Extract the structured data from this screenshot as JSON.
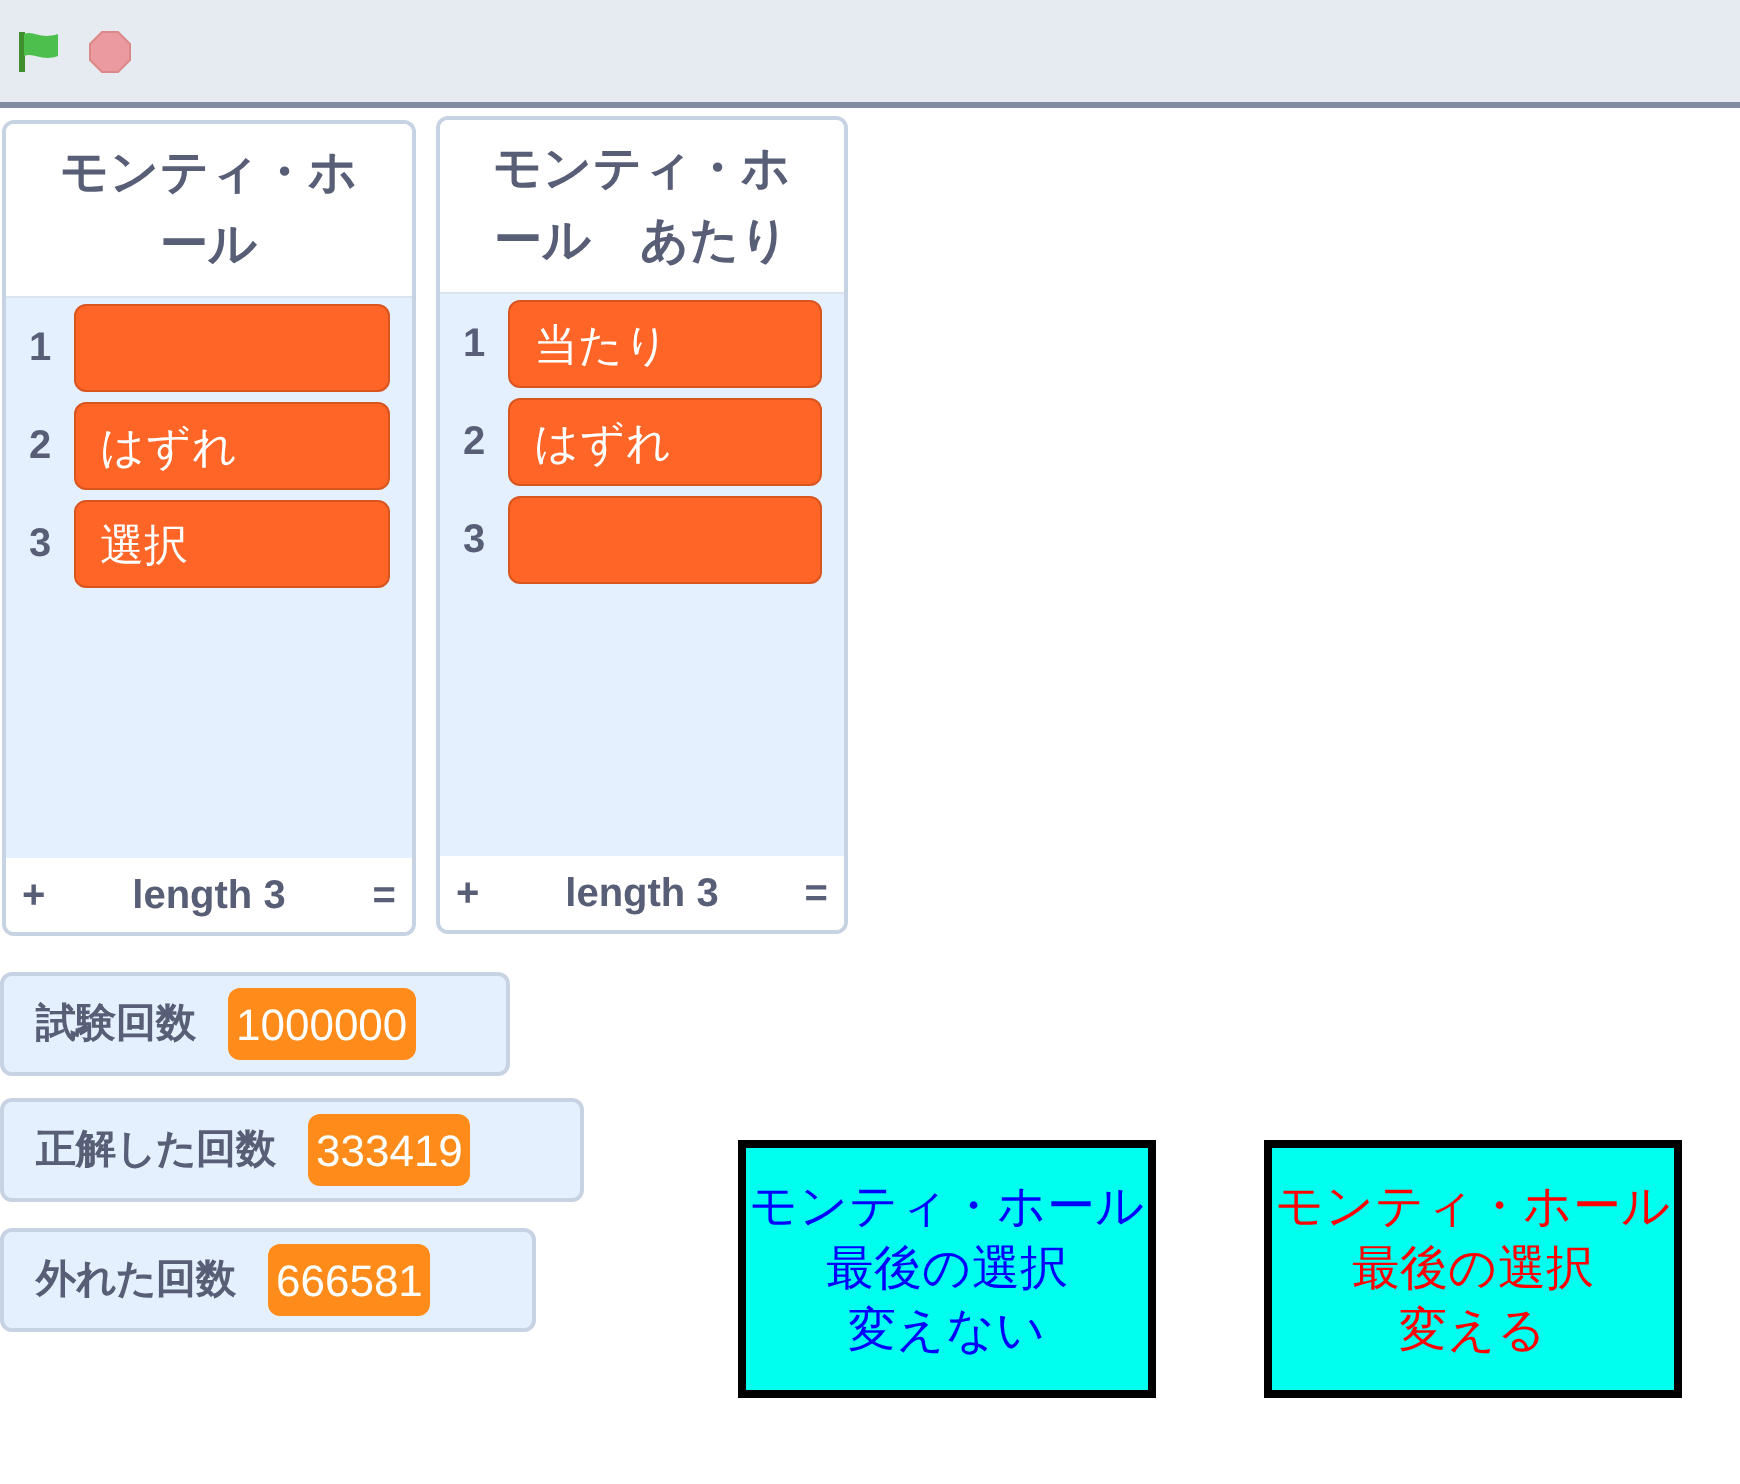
{
  "lists": [
    {
      "title": "モンティ・ホール",
      "items": [
        {
          "index": "1",
          "value": ""
        },
        {
          "index": "2",
          "value": "はずれ"
        },
        {
          "index": "3",
          "value": "選択"
        }
      ],
      "add": "+",
      "length": "length 3",
      "resize": "="
    },
    {
      "title": "モンティ・ホール　あたり",
      "items": [
        {
          "index": "1",
          "value": "当たり"
        },
        {
          "index": "2",
          "value": "はずれ"
        },
        {
          "index": "3",
          "value": ""
        }
      ],
      "add": "+",
      "length": "length 3",
      "resize": "="
    }
  ],
  "variables": [
    {
      "label": "試験回数",
      "value": "1000000"
    },
    {
      "label": "正解した回数",
      "value": "333419"
    },
    {
      "label": "外れた回数",
      "value": "666581"
    }
  ],
  "sprites": [
    {
      "lines": [
        "モンティ・ホール",
        "最後の選択",
        "変えない"
      ],
      "color": "#0000ff"
    },
    {
      "lines": [
        "モンティ・ホール",
        "最後の選択",
        "変える"
      ],
      "color": "#ff0000"
    }
  ]
}
